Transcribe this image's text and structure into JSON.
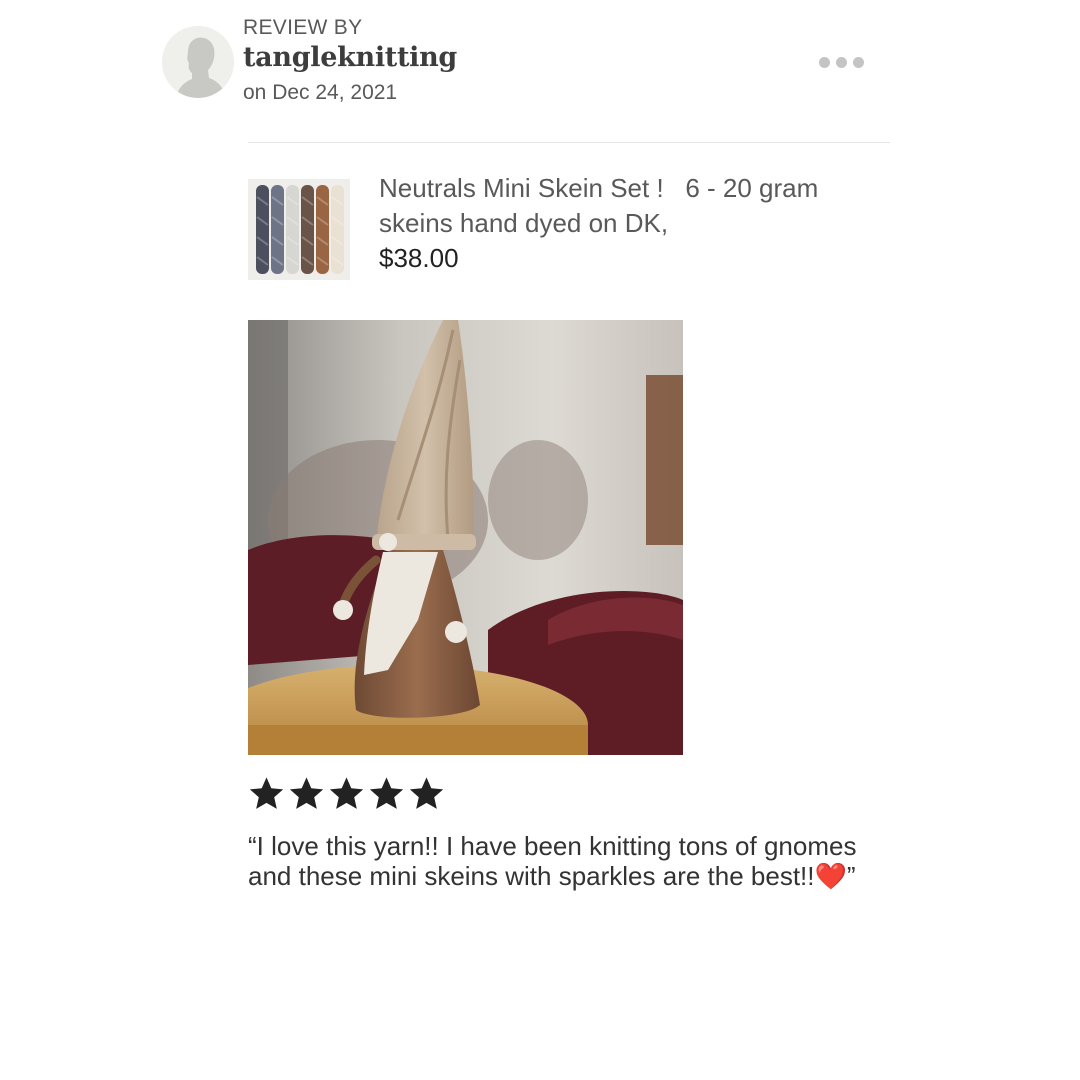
{
  "review": {
    "header_label": "REVIEW BY",
    "username": "tangleknitting",
    "date": "on Dec 24, 2021",
    "rating": 5,
    "rating_max": 5,
    "text": "“I love this yarn!! I have been knitting tons of gnomes and these mini skeins with sparkles are the best!!❤️”"
  },
  "listing": {
    "title": "Neutrals Mini Skein Set !   6 - 20 gram skeins hand dyed on DK,",
    "price": "$38.00",
    "skein_colors": [
      "#4b4f5e",
      "#6d7488",
      "#d6d6d2",
      "#6a5448",
      "#9a6543",
      "#e9e1d2"
    ]
  },
  "icons": {
    "more": "more-options-icon",
    "avatar": "default-avatar-icon",
    "star": "star-icon"
  },
  "colors": {
    "star": "#222222",
    "divider": "#e6e6e6",
    "muted_text": "#595959"
  }
}
